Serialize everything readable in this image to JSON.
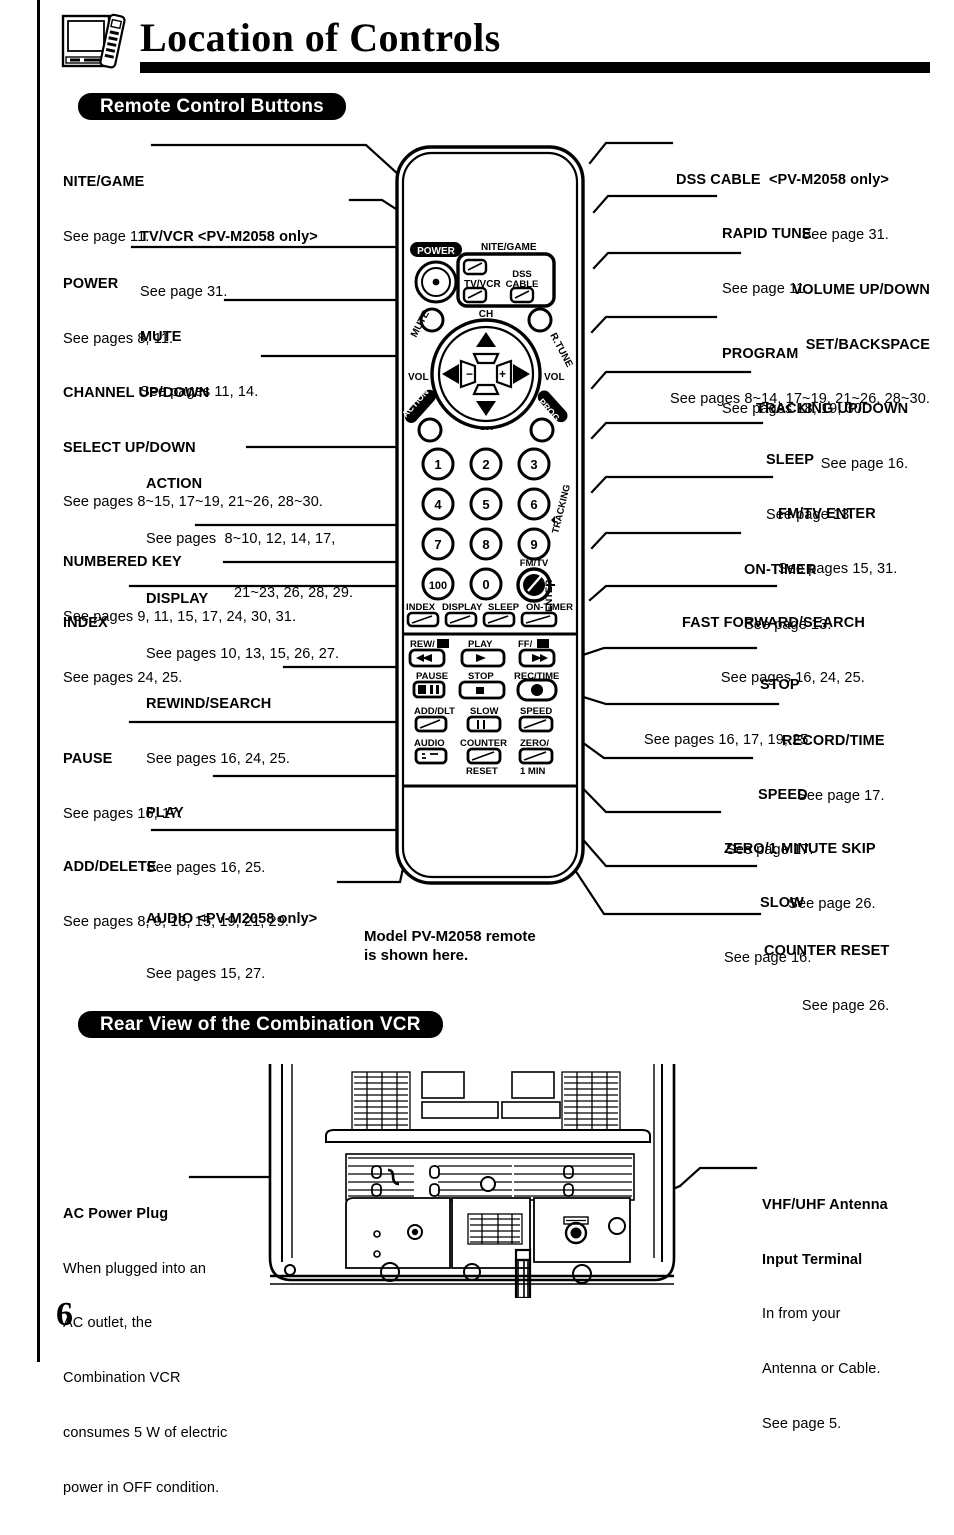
{
  "header": {
    "title": "Location of Controls",
    "icon": "tv-vcr-remote-icon"
  },
  "page_number": "6",
  "sections": {
    "remote_banner": "Remote Control Buttons",
    "rear_banner": "Rear View of the Combination VCR"
  },
  "model_note": {
    "line1": "Model PV-M2058 remote",
    "line2": "is shown here."
  },
  "left_callouts": [
    {
      "title": "NITE/GAME",
      "sub": [
        "See page 11."
      ],
      "align": "left"
    },
    {
      "title": "TV/VCR <PV-M2058 only>",
      "sub": [
        "See page 31."
      ],
      "align": "left"
    },
    {
      "title": "POWER",
      "sub": [
        "See pages 8, 11."
      ],
      "align": "left"
    },
    {
      "title": "MUTE",
      "sub": [
        "See pages 11, 14."
      ],
      "align": "left"
    },
    {
      "title": "CHANNEL UP/DOWN",
      "sub": [
        "SELECT UP/DOWN",
        "See pages 8~15, 17~19, 21~26, 28~30."
      ],
      "align": "left"
    },
    {
      "title": "ACTION",
      "sub": [
        "See pages  8~10, 12, 14, 17,",
        "21~23, 26, 28, 29."
      ],
      "align": "left"
    },
    {
      "title": "NUMBERED KEY",
      "sub": [
        "See pages 9, 11, 15, 17, 24, 30, 31."
      ],
      "align": "left"
    },
    {
      "title": "DISPLAY",
      "sub": [
        "See pages 10, 13, 15, 26, 27."
      ],
      "align": "left"
    },
    {
      "title": "INDEX",
      "sub": [
        "See pages 24, 25."
      ],
      "align": "left"
    },
    {
      "title": "REWIND/SEARCH",
      "sub": [
        "See pages 16, 24, 25."
      ],
      "align": "left"
    },
    {
      "title": "PAUSE",
      "sub": [
        "See pages 16, 17."
      ],
      "align": "left"
    },
    {
      "title": "PLAY",
      "sub": [
        "See pages 16, 25."
      ],
      "align": "left"
    },
    {
      "title": "ADD/DELETE",
      "sub": [
        "See pages 8, 9, 13, 15, 19, 21, 29."
      ],
      "align": "left"
    },
    {
      "title": "AUDIO <PV-M2058 only>",
      "sub": [
        "See pages 15, 27."
      ],
      "align": "left"
    }
  ],
  "right_callouts": [
    {
      "title": "DSS CABLE  <PV-M2058 only>",
      "sub": [
        "See page 31."
      ]
    },
    {
      "title": "RAPID TUNE",
      "sub": [
        "See page 11."
      ]
    },
    {
      "title": "VOLUME UP/DOWN",
      "sub": [
        "SET/BACKSPACE",
        "See pages 8~14, 17~19, 21~26, 28~30."
      ]
    },
    {
      "title": "PROGRAM",
      "sub": [
        "See pages 18, 19, 30."
      ]
    },
    {
      "title": "TRACKING UP/DOWN",
      "sub": [
        "See page 16."
      ]
    },
    {
      "title": "SLEEP",
      "sub": [
        "See page 13."
      ]
    },
    {
      "title": "FM/TV ENTER",
      "sub": [
        "See pages 15, 31."
      ]
    },
    {
      "title": "ON-TIMER",
      "sub": [
        "See page 13."
      ]
    },
    {
      "title": "FAST FORWARD/SEARCH",
      "sub": [
        "See pages 16, 24, 25."
      ]
    },
    {
      "title": "STOP",
      "sub": [
        "See pages 16, 17, 19, 25."
      ]
    },
    {
      "title": "RECORD/TIME",
      "sub": [
        "See page 17."
      ]
    },
    {
      "title": "SPEED",
      "sub": [
        "See page 17."
      ]
    },
    {
      "title": "ZERO/1 MINUTE SKIP",
      "sub": [
        "See page 26."
      ]
    },
    {
      "title": "SLOW",
      "sub": [
        "See page 16."
      ]
    },
    {
      "title": "COUNTER RESET",
      "sub": [
        "See page 26."
      ]
    }
  ],
  "rear_callouts": {
    "left": {
      "title": "AC Power Plug",
      "sub": [
        "When plugged into an",
        "AC outlet, the",
        "Combination VCR",
        "consumes 5 W of electric",
        "power in OFF condition."
      ]
    },
    "right": {
      "title": "VHF/UHF Antenna",
      "title2": "Input Terminal",
      "sub": [
        "In from your",
        "Antenna or Cable.",
        "See page 5."
      ]
    }
  },
  "remote_art": {
    "power_label": "POWER",
    "nite_game_label": "NITE/GAME",
    "tv_vcr_label": "TV/VCR",
    "dss_cable_label": "DSS\nCABLE",
    "mute_label": "MUTE",
    "ch_top_label": "CH",
    "ch_bottom_label": "CH",
    "vol_left_label": "VOL",
    "vol_right_label": "VOL",
    "action_label": "ACTION",
    "rtune_label": "R.TUNE",
    "prog_label": "PROG",
    "tracking_label": "TRACKING",
    "fmtv_label": "FM/TV",
    "enter_label": "ENTER",
    "keypad": [
      "1",
      "2",
      "3",
      "4",
      "5",
      "6",
      "7",
      "8",
      "9",
      "100",
      "0"
    ],
    "row_index": [
      "INDEX",
      "DISPLAY",
      "SLEEP",
      "ON-TIMER"
    ],
    "row_transport1": [
      "REW/",
      "PLAY",
      "FF/"
    ],
    "row_transport2": [
      "PAUSE",
      "STOP",
      "REC/TIME"
    ],
    "row_transport3": [
      "ADD/DLT",
      "SLOW",
      "SPEED"
    ],
    "row_transport4": [
      "AUDIO",
      "COUNTER",
      "ZERO/"
    ],
    "row_transport5": [
      "RESET",
      "1 MIN"
    ]
  },
  "colors": {
    "ink": "#000000",
    "paper": "#ffffff"
  }
}
